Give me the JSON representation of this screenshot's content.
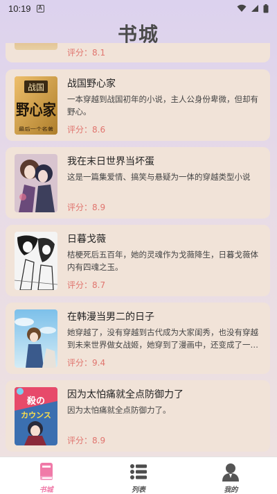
{
  "status_bar": {
    "time": "10:19",
    "notification_icon": "A"
  },
  "header": {
    "title": "书城"
  },
  "books": [
    {
      "title": "",
      "description": "",
      "rating": "评分：8.1"
    },
    {
      "title": "战国野心家",
      "description": "一本穿越到战国初年的小说，主人公身份卑微，但却有野心。",
      "rating": "评分：8.6",
      "cover_text": [
        "战国",
        "野心家",
        "最后一个名著"
      ]
    },
    {
      "title": "我在末日世界当坏蛋",
      "description": "这是一篇集爱情、搞笑与悬疑为一体的穿越类型小说",
      "rating": "评分：8.9"
    },
    {
      "title": "日暮戈薇",
      "description": "桔梗死后五百年，她的灵魂作为戈薇降生，日暮戈薇体内有四魂之玉。",
      "rating": "评分：8.7"
    },
    {
      "title": "在韩漫当男二的日子",
      "description": "她穿越了，没有穿越到古代成为大家闺秀，也没有穿越到未来世界做女战姬，她穿到了漫画中，还变成了一个人见人厌的男二。",
      "rating": "评分：9.4"
    },
    {
      "title": "因为太怕痛就全点防御力了",
      "description": "因为太怕痛就全点防御力了。",
      "rating": "评分：8.9",
      "cover_text": [
        "殺の",
        "カウンス"
      ]
    }
  ],
  "tabs": [
    {
      "label": "书城",
      "icon": "book-icon",
      "active": true
    },
    {
      "label": "列表",
      "icon": "list-icon",
      "active": false
    },
    {
      "label": "我的",
      "icon": "user-icon",
      "active": false
    }
  ],
  "colors": {
    "accent": "#f07aa8",
    "rating": "#e0746e",
    "card_bg": "#f1e3d8"
  }
}
